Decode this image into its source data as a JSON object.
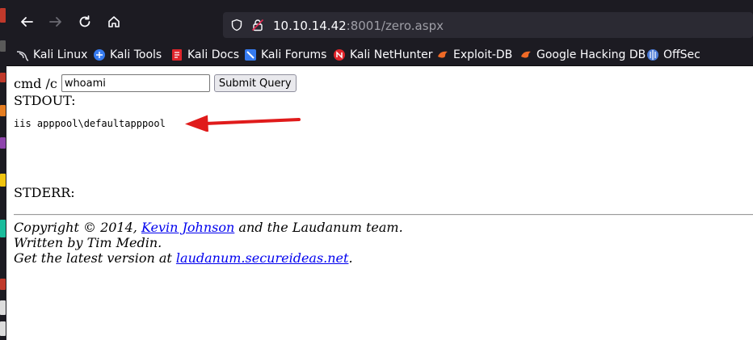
{
  "browser": {
    "url_host": "10.10.14.42",
    "url_rest": ":8001/zero.aspx"
  },
  "bookmarks": [
    {
      "label": "Kali Linux",
      "icon": "kali-dragon-icon"
    },
    {
      "label": "Kali Tools",
      "icon": "kali-tools-icon"
    },
    {
      "label": "Kali Docs",
      "icon": "kali-docs-icon"
    },
    {
      "label": "Kali Forums",
      "icon": "kali-forums-icon"
    },
    {
      "label": "Kali NetHunter",
      "icon": "kali-nethunter-icon"
    },
    {
      "label": "Exploit-DB",
      "icon": "exploit-db-icon"
    },
    {
      "label": "Google Hacking DB",
      "icon": "ghdb-icon"
    },
    {
      "label": "OffSec",
      "icon": "offsec-icon"
    }
  ],
  "form": {
    "prefix": "cmd /c",
    "command_value": "whoami",
    "submit_label": "Submit Query"
  },
  "output": {
    "stdout_label": "STDOUT:",
    "stdout_text": "iis apppool\\defaultapppool",
    "stderr_label": "STDERR:"
  },
  "footer": {
    "copyright_prefix": "Copyright © 2014, ",
    "author_link": "Kevin Johnson",
    "copyright_suffix": " and the Laudanum team.",
    "written_by": "Written by Tim Medin.",
    "latest_prefix": "Get the latest version at ",
    "latest_link": "laudanum.secureideas.net",
    "latest_suffix": "."
  },
  "colors": {
    "chrome_bg": "#1c1b22",
    "urlbar_bg": "#2b2a33",
    "link": "#0000ee",
    "annotation_arrow": "#e01b1b"
  }
}
